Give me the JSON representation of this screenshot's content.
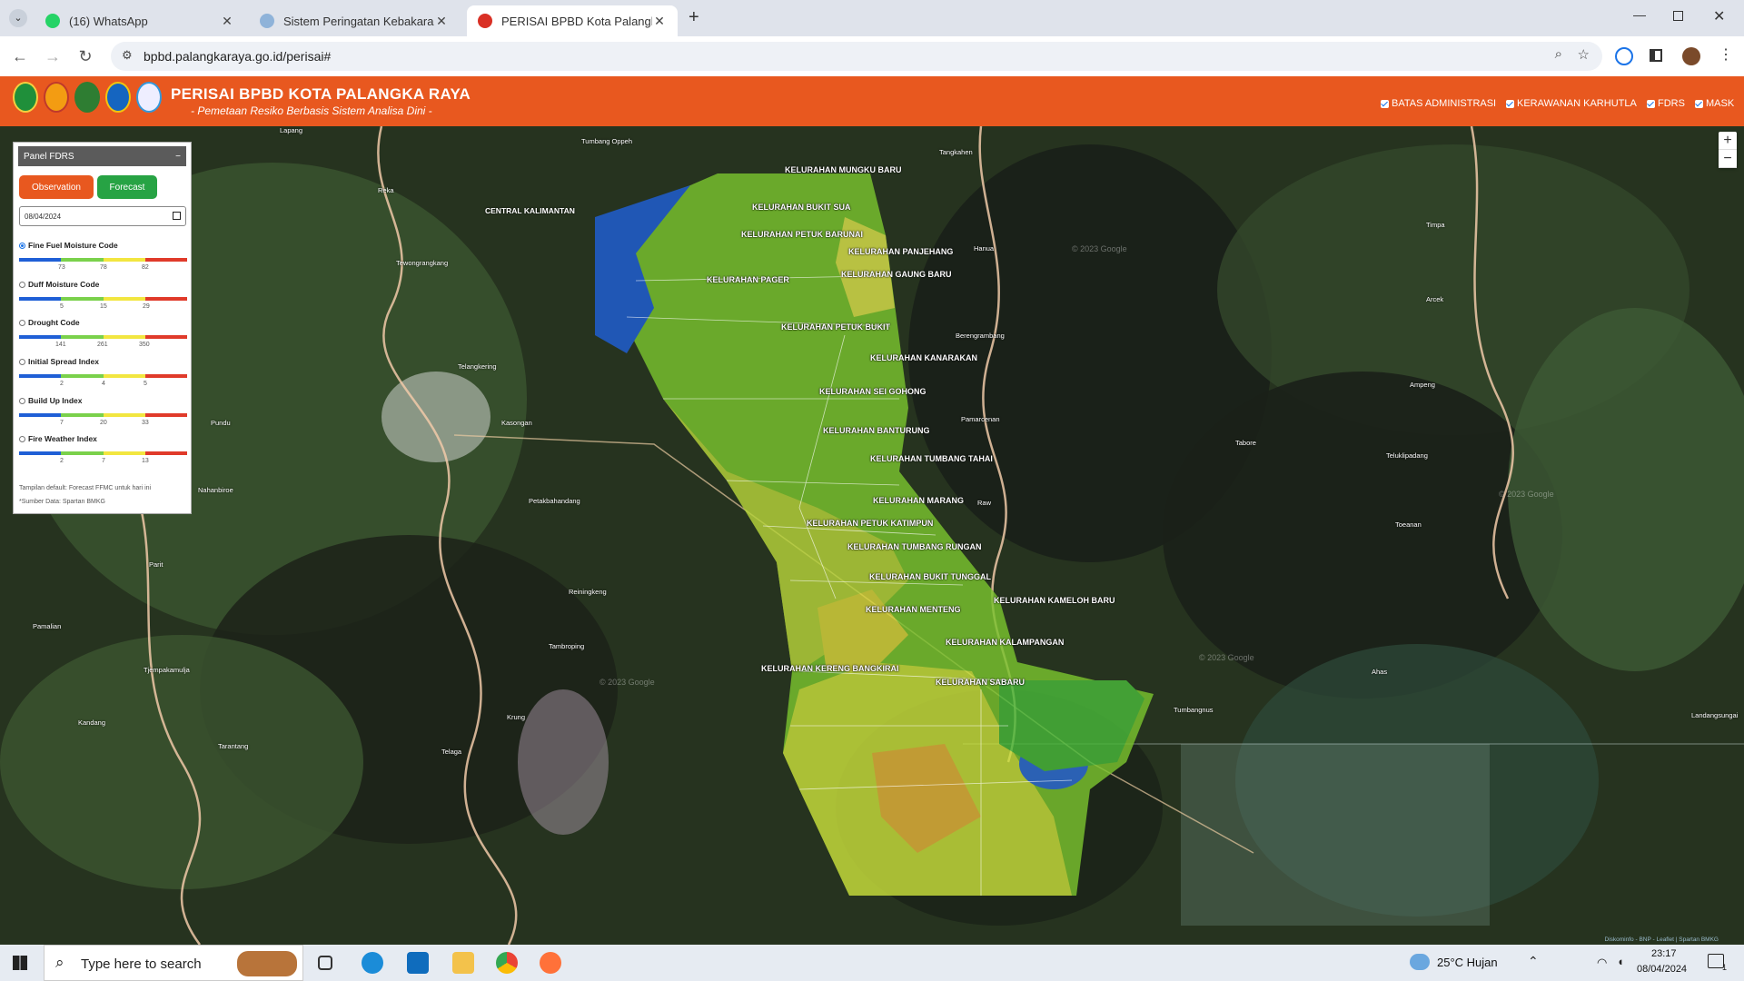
{
  "browser": {
    "tabs": [
      {
        "title": "(16) WhatsApp"
      },
      {
        "title": "Sistem Peringatan Kebakaran H"
      },
      {
        "title": "PERISAI BPBD Kota Palangka Ra"
      }
    ],
    "url": "bpbd.palangkaraya.go.id/perisai#"
  },
  "header": {
    "title": "PERISAI BPBD KOTA PALANGKA RAYA",
    "subtitle": "- Pemetaan Resiko Berbasis Sistem Analisa Dini -",
    "layers": [
      "BATAS ADMINISTRASI",
      "KERAWANAN KARHUTLA",
      "FDRS",
      "MASK"
    ]
  },
  "panel": {
    "title": "Panel FDRS",
    "collapse": "−",
    "observation_label": "Observation",
    "forecast_label": "Forecast",
    "date_value": "08/04/2024",
    "indices": [
      {
        "name": "Fine Fuel Moisture Code",
        "selected": true,
        "ticks": [
          "73",
          "78",
          "82"
        ]
      },
      {
        "name": "Duff Moisture Code",
        "selected": false,
        "ticks": [
          "5",
          "15",
          "29"
        ]
      },
      {
        "name": "Drought Code",
        "selected": false,
        "ticks": [
          "141",
          "261",
          "350"
        ]
      },
      {
        "name": "Initial Spread Index",
        "selected": false,
        "ticks": [
          "2",
          "4",
          "5"
        ]
      },
      {
        "name": "Build Up Index",
        "selected": false,
        "ticks": [
          "7",
          "20",
          "33"
        ]
      },
      {
        "name": "Fire Weather Index",
        "selected": false,
        "ticks": [
          "2",
          "7",
          "13"
        ]
      }
    ],
    "scale_colors": [
      "#1f5fd6",
      "#7ad14b",
      "#f2e640",
      "#e03a2a"
    ],
    "note1": "Tampilan default: Forecast FFMC untuk hari ini",
    "note2": "*Sumber Data: Spartan BMKG"
  },
  "map": {
    "zoom_in": "+",
    "zoom_out": "−",
    "kelurahan": [
      "KELURAHAN MUNGKU BARU",
      "KELURAHAN BUKIT SUA",
      "KELURAHAN PETUK BARUNAI",
      "KELURAHAN PANJEHANG",
      "KELURAHAN GAUNG BARU",
      "KELURAHAN PAGER",
      "KELURAHAN PETUK BUKIT",
      "KELURAHAN KANARAKAN",
      "KELURAHAN SEI GOHONG",
      "KELURAHAN BANTURUNG",
      "KELURAHAN TUMBANG TAHAI",
      "KELURAHAN MARANG",
      "KELURAHAN PETUK KATIMPUN",
      "KELURAHAN TUMBANG RUNGAN",
      "KELURAHAN BUKIT TUNGGAL",
      "KELURAHAN KAMELOH BARU",
      "KELURAHAN MENTENG",
      "KELURAHAN KALAMPANGAN",
      "KELURAHAN KERENG BANGKIRAI",
      "KELURAHAN SABARU"
    ],
    "places": [
      "Lapang",
      "Tumbang Oppeh",
      "Tangkahen",
      "Reka",
      "CENTRAL KALIMANTAN",
      "Tewongrangkang",
      "Hanua",
      "Timpa",
      "Arcek",
      "Berengrambang",
      "Telangkering",
      "Ampeng",
      "Pundu",
      "Kasongan",
      "Pamarcenan",
      "Tabore",
      "Teluklipadang",
      "Nahanbiroe",
      "Petakbahandang",
      "Raw",
      "Toeanan",
      "Parit",
      "Pamalian",
      "Tjempakamulja",
      "Kandang",
      "Tarantang",
      "Telaga",
      "Krung",
      "Tambroping",
      "Reiningkeng",
      "Tumbangnus",
      "Ahas",
      "Landangsungai"
    ],
    "watermark": "© 2023 Google",
    "attribution": "Diskominfo - BNP - Leaflet | Spartan BMKG"
  },
  "taskbar": {
    "search_placeholder": "Type here to search",
    "weather": "25°C  Hujan",
    "time": "23:17",
    "date": "08/04/2024",
    "notif_count": "1"
  }
}
